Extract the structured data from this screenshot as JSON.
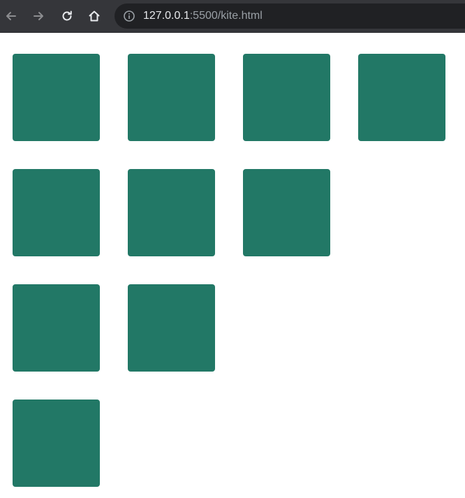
{
  "browser": {
    "url_host": "127.0.0.1",
    "url_rest": ":5500/kite.html",
    "icons": {
      "back": "arrow-left-icon",
      "forward": "arrow-right-icon",
      "reload": "reload-icon",
      "home": "home-icon",
      "site_info": "info-circle-icon"
    }
  },
  "page": {
    "tile_color": "#227866",
    "rows": [
      4,
      3,
      2,
      1
    ]
  }
}
